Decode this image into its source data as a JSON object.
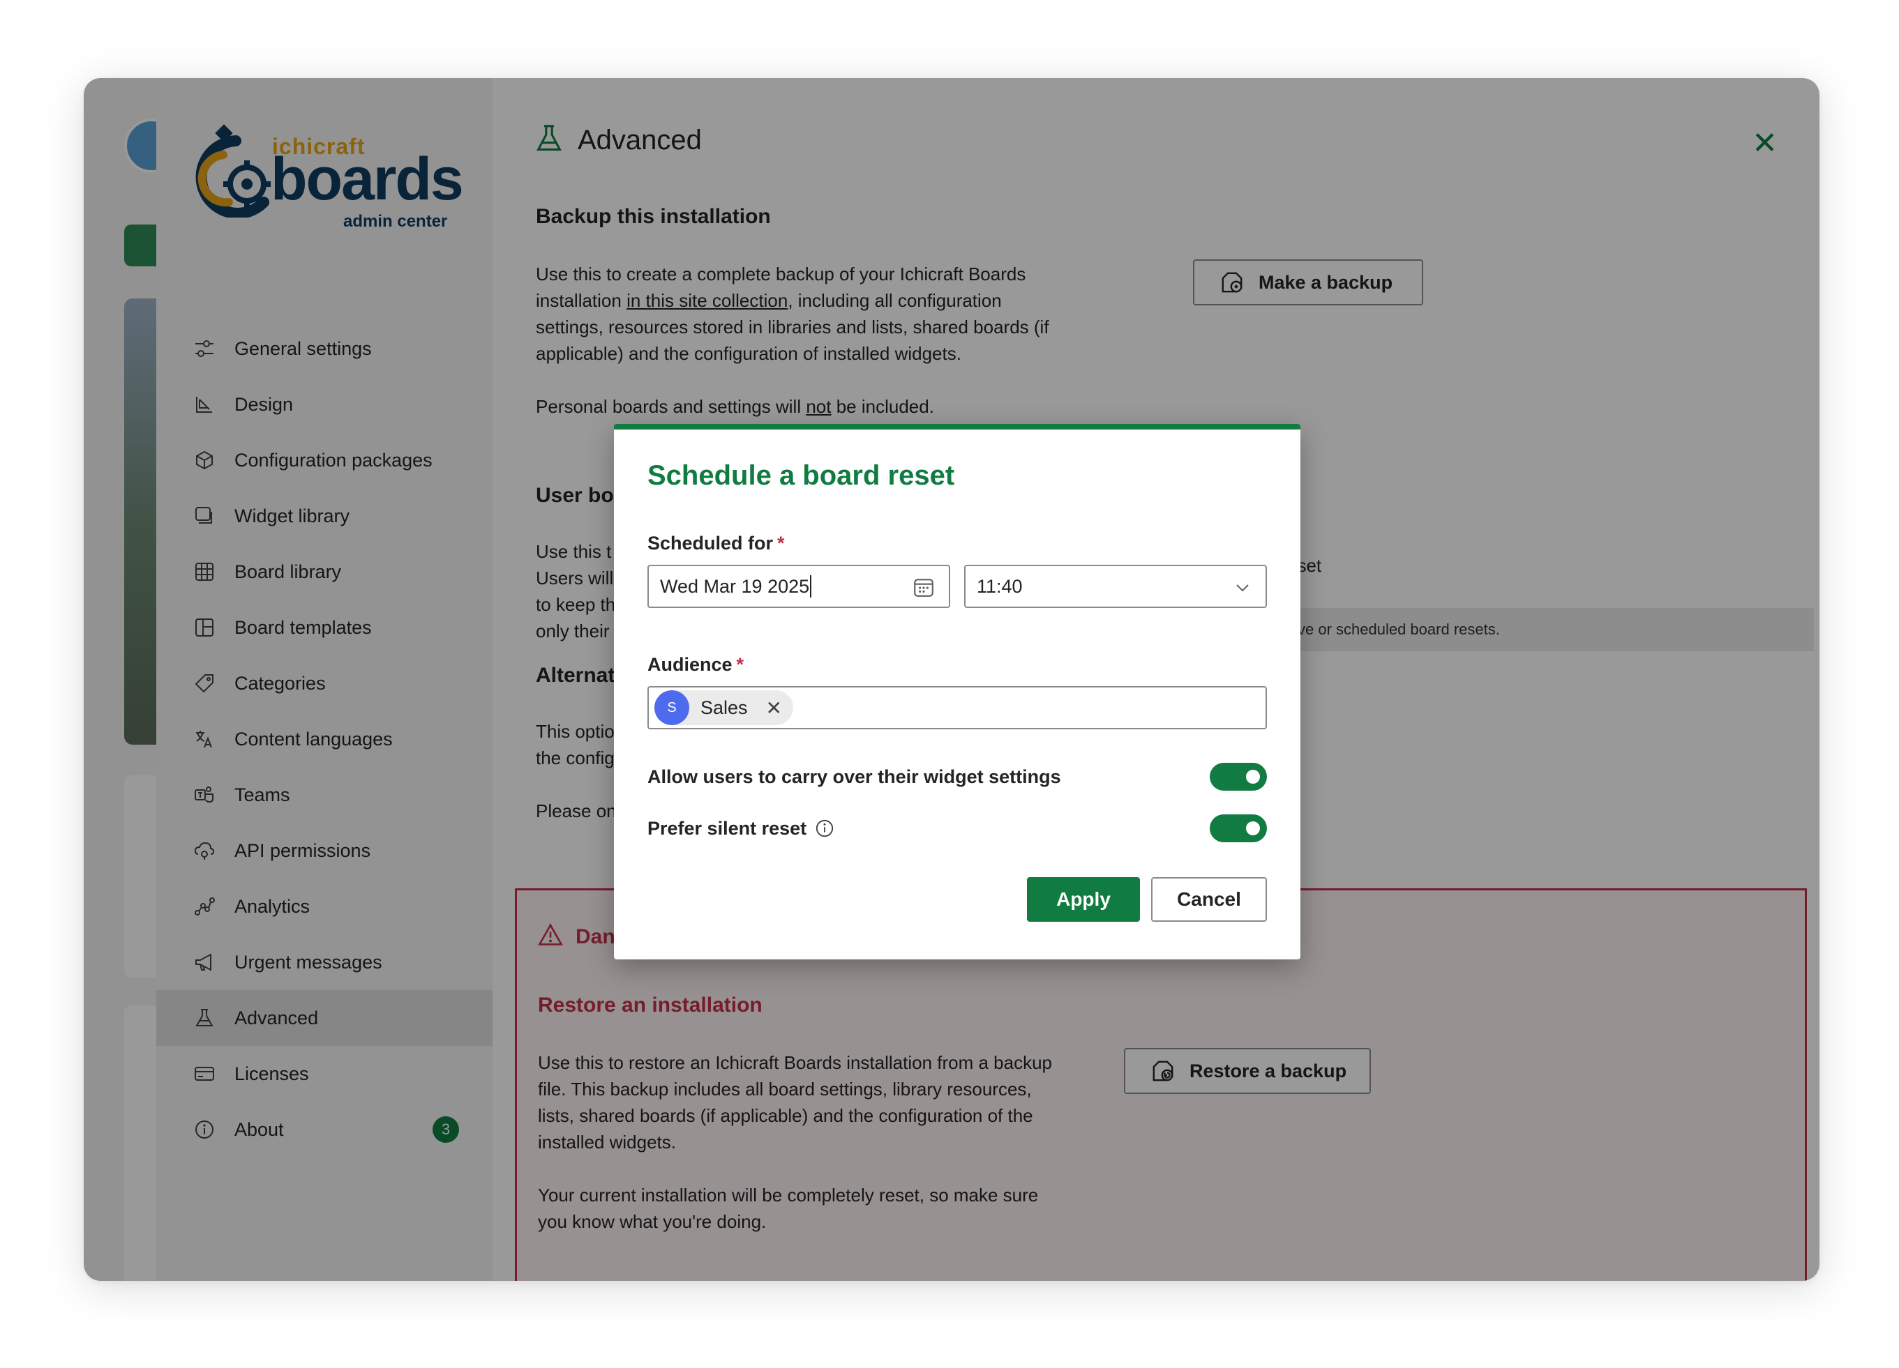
{
  "brand": {
    "top": "ichicraft",
    "main": "boards",
    "sub": "admin center"
  },
  "sidebar": {
    "items": [
      {
        "label": "General settings",
        "icon": "sliders-icon"
      },
      {
        "label": "Design",
        "icon": "design-icon"
      },
      {
        "label": "Configuration packages",
        "icon": "package-icon"
      },
      {
        "label": "Widget library",
        "icon": "widget-icon"
      },
      {
        "label": "Board library",
        "icon": "grid-icon"
      },
      {
        "label": "Board templates",
        "icon": "template-icon"
      },
      {
        "label": "Categories",
        "icon": "tag-icon"
      },
      {
        "label": "Content languages",
        "icon": "translate-icon"
      },
      {
        "label": "Teams",
        "icon": "teams-icon"
      },
      {
        "label": "API permissions",
        "icon": "api-icon"
      },
      {
        "label": "Analytics",
        "icon": "analytics-icon"
      },
      {
        "label": "Urgent messages",
        "icon": "megaphone-icon"
      },
      {
        "label": "Advanced",
        "icon": "flask-icon",
        "active": true
      },
      {
        "label": "Licenses",
        "icon": "card-icon"
      },
      {
        "label": "About",
        "icon": "info-icon",
        "badge": "3"
      }
    ]
  },
  "main": {
    "title": "Advanced",
    "backup": {
      "heading": "Backup this installation",
      "text1": "Use this to create a complete backup of your Ichicraft Boards",
      "text2a": "installation ",
      "text2link": "in this site collection",
      "text2b": ", including all configuration",
      "text3": "settings, resources stored in libraries and lists, shared boards (if",
      "text4": "applicable) and the configuration of installed widgets.",
      "text5a": "Personal boards and settings will ",
      "text5u": "not",
      "text5b": " be included.",
      "button": "Make a backup"
    },
    "user_boards": {
      "heading": "User bo",
      "line1": "Use this t",
      "line2": "Users will",
      "line3": "to keep th",
      "line4": "only their",
      "right_text": "rd reset",
      "strip": "ve or scheduled board resets."
    },
    "alternative": {
      "heading": "Alternat",
      "line1": "This optio",
      "line2": "the config",
      "line3": "Please on"
    },
    "danger": {
      "heading": "Dan",
      "restore_heading": "Restore an installation",
      "text1": "Use this to restore an Ichicraft Boards installation from a backup",
      "text2": "file. This backup includes all board settings, library resources,",
      "text3": "lists, shared boards (if applicable) and the configuration of the",
      "text4": "installed widgets.",
      "text5": "Your current installation will be completely reset, so make sure",
      "text6": "you know what you're doing.",
      "button": "Restore a backup"
    }
  },
  "dialog": {
    "title": "Schedule a board reset",
    "scheduled_label": "Scheduled for",
    "required_mark": "*",
    "date_value": "Wed Mar 19 2025",
    "time_value": "11:40",
    "audience_label": "Audience",
    "audience_chip": {
      "initial": "S",
      "name": "Sales"
    },
    "toggle1_label": "Allow users to carry over their widget settings",
    "toggle1_on": true,
    "toggle2_label": "Prefer silent reset",
    "toggle2_on": true,
    "apply": "Apply",
    "cancel": "Cancel"
  },
  "colors": {
    "accent": "#107c41",
    "danger": "#c4314b",
    "chip_avatar": "#4f6bed"
  }
}
